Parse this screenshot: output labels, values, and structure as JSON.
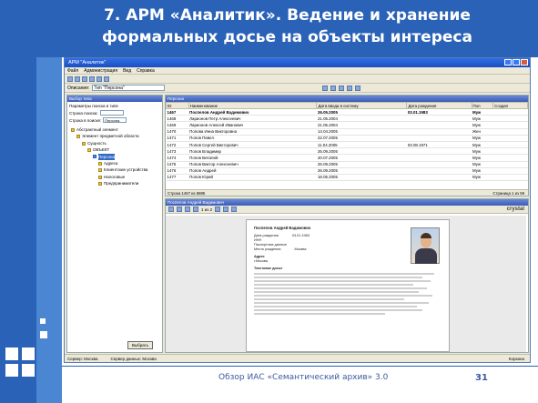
{
  "slide": {
    "title_line1": "7. АРМ «Аналитик». Ведение и хранение",
    "title_line2": "формальных досье на объекты интереса",
    "footer": "Обзор ИАС «Семантический архив» 3.0",
    "page_number": "31",
    "colors": {
      "primary": "#2a62b7",
      "accent": "#4a86d2"
    }
  },
  "window": {
    "title": "АРМ \"Аналитик\"",
    "menu": [
      "Файл",
      "Администрация",
      "Вид",
      "Справка"
    ],
    "combo_label": "Описание:",
    "combo_value": "Тип \"Персона\""
  },
  "left_pane": {
    "header": "Выбор типа",
    "search_label": "Параметры поиска в типе",
    "search_row1_label": "Строка поиска:",
    "search_row1_value": "",
    "search_row2_label": "Строка в поиске:",
    "search_row2_value": "Персона",
    "tree": [
      {
        "label": "Абстрактный элемент",
        "indent": 0
      },
      {
        "label": "Элемент предметной области",
        "indent": 1
      },
      {
        "label": "Сущность",
        "indent": 2
      },
      {
        "label": "ОБЪЕКТ",
        "indent": 3
      },
      {
        "label": "Персона",
        "indent": 4,
        "selected": true
      },
      {
        "label": "Адреса",
        "indent": 5
      },
      {
        "label": "Клиентские устройства",
        "indent": 5
      },
      {
        "label": "Налоговые",
        "indent": 5
      },
      {
        "label": "Предприниматели",
        "indent": 5
      }
    ],
    "choose_button": "Выбрать"
  },
  "grid": {
    "header": "Персона",
    "columns": [
      "ID",
      "Наименование",
      "Дата ввода в систему",
      "Дата рождения",
      "Пол",
      "Создал"
    ],
    "rows": [
      [
        "1467",
        "Поспелов Андрей Вадимович",
        "26.05.2005",
        "03.01.1983",
        "Муж",
        ""
      ],
      [
        "1468",
        "Ларионов Петр Алексеевич",
        "21.05.2004",
        "",
        "Муж",
        ""
      ],
      [
        "1469",
        "Ларионов Алексей Иванович",
        "21.05.2004",
        "",
        "Муж",
        ""
      ],
      [
        "1470",
        "Попова Инна Викторовна",
        "14.04.2005",
        "",
        "Жен",
        ""
      ],
      [
        "1471",
        "Попов Павел",
        "22.07.2005",
        "",
        "Муж",
        ""
      ],
      [
        "1472",
        "Попов Сергей Викторович",
        "11.04.2005",
        "03.08.1971",
        "Муж",
        ""
      ],
      [
        "1473",
        "Попов Владимир",
        "26.09.2005",
        "",
        "Муж",
        ""
      ],
      [
        "1474",
        "Попов Виталий",
        "20.07.2005",
        "",
        "Муж",
        ""
      ],
      [
        "1475",
        "Попов Виктор Алексеевич",
        "26.09.2005",
        "",
        "Муж",
        ""
      ],
      [
        "1476",
        "Попов Андрей",
        "26.09.2005",
        "",
        "Муж",
        ""
      ],
      [
        "1477",
        "Попов Юрий",
        "18.05.2005",
        "",
        "Муж",
        ""
      ]
    ],
    "status": "Строка 1467 из 5885",
    "page": "Страница 1 из 59"
  },
  "document": {
    "header": "Поспелов Андрей Вадимович",
    "page_label": "1 из 2",
    "brand": "crystal",
    "person_name": "Поспелов Андрей Вадимович",
    "fields": [
      [
        "Дата рождения",
        "03.01.1983"
      ],
      [
        "ИНН",
        ""
      ],
      [
        "Паспортные данные",
        ""
      ],
      [
        "Место рождения",
        "Москва"
      ]
    ],
    "address_label": "Адрес",
    "address_value": "г.Москва",
    "dossier_label": "Текстовое досье"
  },
  "status_bar": {
    "server": "Сервер: Москва",
    "user": "Сервер данных: Москва",
    "right": "Корзина"
  }
}
